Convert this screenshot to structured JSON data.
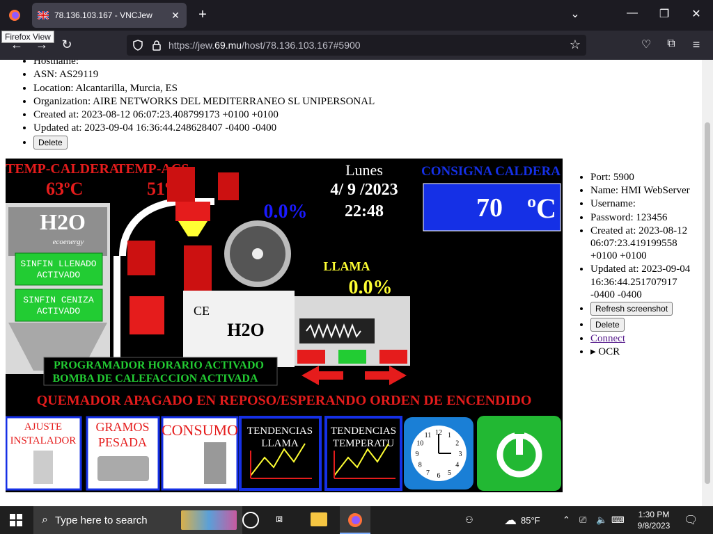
{
  "browser": {
    "tab_title": "78.136.103.167 - VNCJew",
    "tooltip": "Firefox View",
    "url_prefix": "https://jew.",
    "url_domain": "69.mu",
    "url_suffix": "/host/78.136.103.167#5900"
  },
  "host_info": {
    "items": [
      "Hostname:",
      "ASN: AS29119",
      "Location: Alcantarilla, Murcia, ES",
      "Organization: AIRE NETWORKS DEL MEDITERRANEO SL UNIPERSONAL",
      "Created at: 2023-08-12 06:07:23.408799173 +0100 +0100",
      "Updated at: 2023-09-04 16:36:44.248628407 -0400 -0400"
    ],
    "delete_label": "Delete"
  },
  "hmi": {
    "temp_caldera_label": "TEMP-CALDERA",
    "temp_caldera_value": "63ºC",
    "temp_acs_label": "TEMP-ACS",
    "temp_acs_value": "51ºC",
    "day": "Lunes",
    "date": "4/ 9 /2023",
    "time": "22:48",
    "consigna_label": "CONSIGNA CALDERA",
    "consigna_value": "70",
    "consigna_unit": "ºC",
    "percent_blue": "0.0%",
    "llama_label": "LLAMA",
    "llama_value": "0.0%",
    "logo_text": "H2O",
    "logo_sub": "ecoenergy",
    "sinfin_llenado": "SINFIN LLENADO ACTIVADO",
    "sinfin_ceniza": "SINFIN CENIZA ACTIVADO",
    "programador": "PROGRAMADOR HORARIO ACTIVADO",
    "bomba": "BOMBA DE CALEFACCION ACTIVADA",
    "quemador": "QUEMADOR APAGADO EN REPOSO/ESPERANDO ORDEN DE ENCENDIDO",
    "ce_mark": "CE",
    "buttons": [
      "AJUSTE INSTALADOR",
      "GRAMOS PESADA",
      "CONSUMO",
      "TENDENCIAS LLAMA",
      "TENDENCIAS TEMPERATU"
    ],
    "clock_numbers": [
      "12",
      "1",
      "2",
      "3",
      "4",
      "5",
      "6",
      "7",
      "8",
      "9",
      "10",
      "11"
    ],
    "colors": {
      "red": "#e51c1c",
      "blue": "#1a1aff",
      "yellow": "#ffff33",
      "green": "#22cc33",
      "panel_blue": "#1530e6"
    }
  },
  "side_info": {
    "port": "Port: 5900",
    "name": "Name: HMI WebServer",
    "username": "Username:",
    "password": "Password: 123456",
    "created": "Created at: 2023-08-12 06:07:23.419199558 +0100 +0100",
    "updated": "Updated at: 2023-09-04 16:36:44.251707917 -0400 -0400",
    "refresh_label": "Refresh screenshot",
    "delete_label": "Delete",
    "connect_label": "Connect",
    "ocr_label": "OCR"
  },
  "taskbar": {
    "search_placeholder": "Type here to search",
    "weather": "85°F",
    "time": "1:30 PM",
    "date": "9/8/2023"
  }
}
